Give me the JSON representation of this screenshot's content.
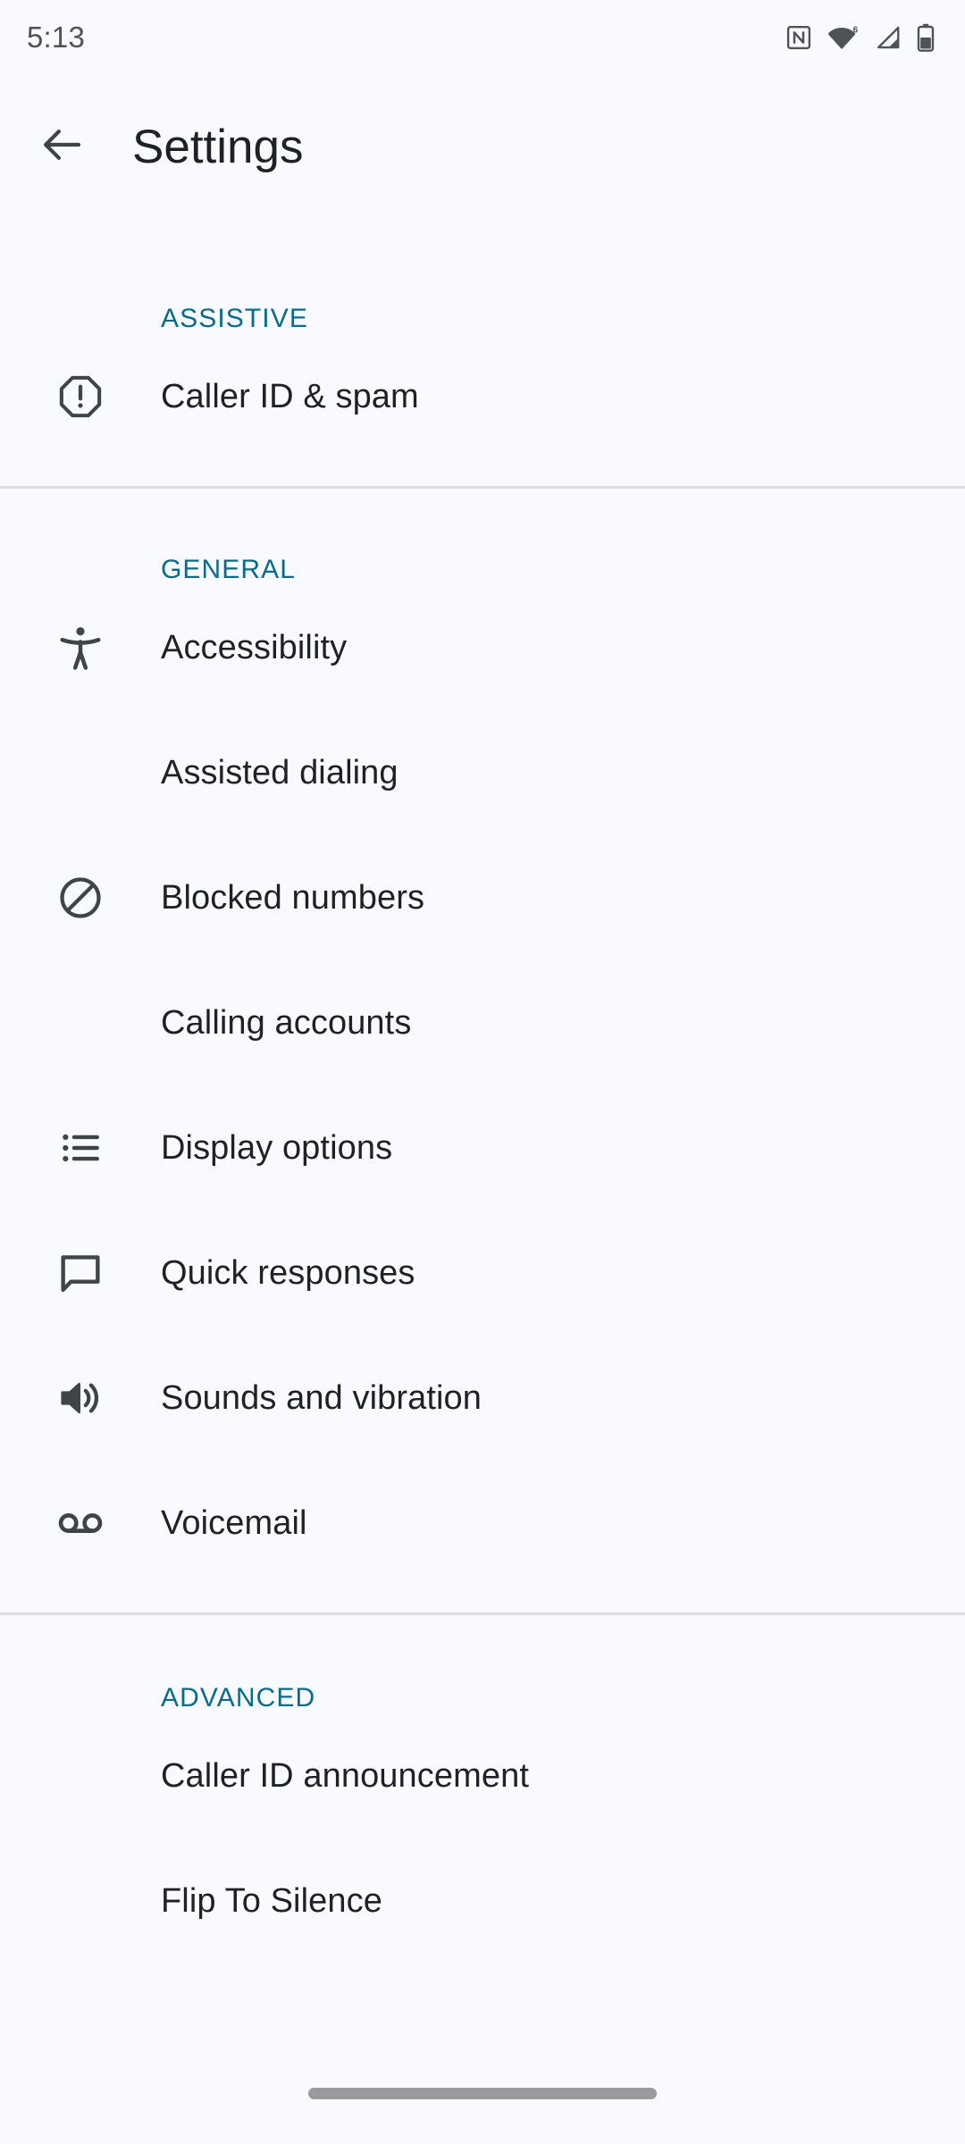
{
  "status_bar": {
    "time": "5:13",
    "icons": [
      {
        "name": "nfc-icon",
        "label": "NFC"
      },
      {
        "name": "wifi-icon",
        "label": "Wi-Fi 6"
      },
      {
        "name": "cellular-signal-icon",
        "label": "Mobile signal"
      },
      {
        "name": "battery-icon",
        "label": "Battery"
      }
    ]
  },
  "app_bar": {
    "back_icon": "back-arrow-icon",
    "title": "Settings"
  },
  "colors": {
    "background": "#f9faff",
    "section_header": "#0a6a8a",
    "primary_text": "#1f2225",
    "icon": "#3f4448",
    "divider": "#dcdde1",
    "status_text": "#4f5358",
    "nav_pill": "#9a9b9f"
  },
  "sections": [
    {
      "id": "assistive",
      "header": "ASSISTIVE",
      "items": [
        {
          "label": "Caller ID & spam",
          "icon": "warning-octagon-icon",
          "has_icon": true
        }
      ]
    },
    {
      "id": "general",
      "header": "GENERAL",
      "items": [
        {
          "label": "Accessibility",
          "icon": "accessibility-person-icon",
          "has_icon": true
        },
        {
          "label": "Assisted dialing",
          "icon": "",
          "has_icon": false
        },
        {
          "label": "Blocked numbers",
          "icon": "block-circle-slash-icon",
          "has_icon": true
        },
        {
          "label": "Calling accounts",
          "icon": "",
          "has_icon": false
        },
        {
          "label": "Display options",
          "icon": "bulleted-list-icon",
          "has_icon": true
        },
        {
          "label": "Quick responses",
          "icon": "chat-bubble-icon",
          "has_icon": true
        },
        {
          "label": "Sounds and vibration",
          "icon": "speaker-volume-icon",
          "has_icon": true
        },
        {
          "label": "Voicemail",
          "icon": "voicemail-reels-icon",
          "has_icon": true
        }
      ]
    },
    {
      "id": "advanced",
      "header": "ADVANCED",
      "items": [
        {
          "label": "Caller ID announcement",
          "icon": "",
          "has_icon": false
        },
        {
          "label": "Flip To Silence",
          "icon": "",
          "has_icon": false
        }
      ]
    }
  ],
  "nav_bar": {
    "handle": "gesture-nav-pill"
  }
}
